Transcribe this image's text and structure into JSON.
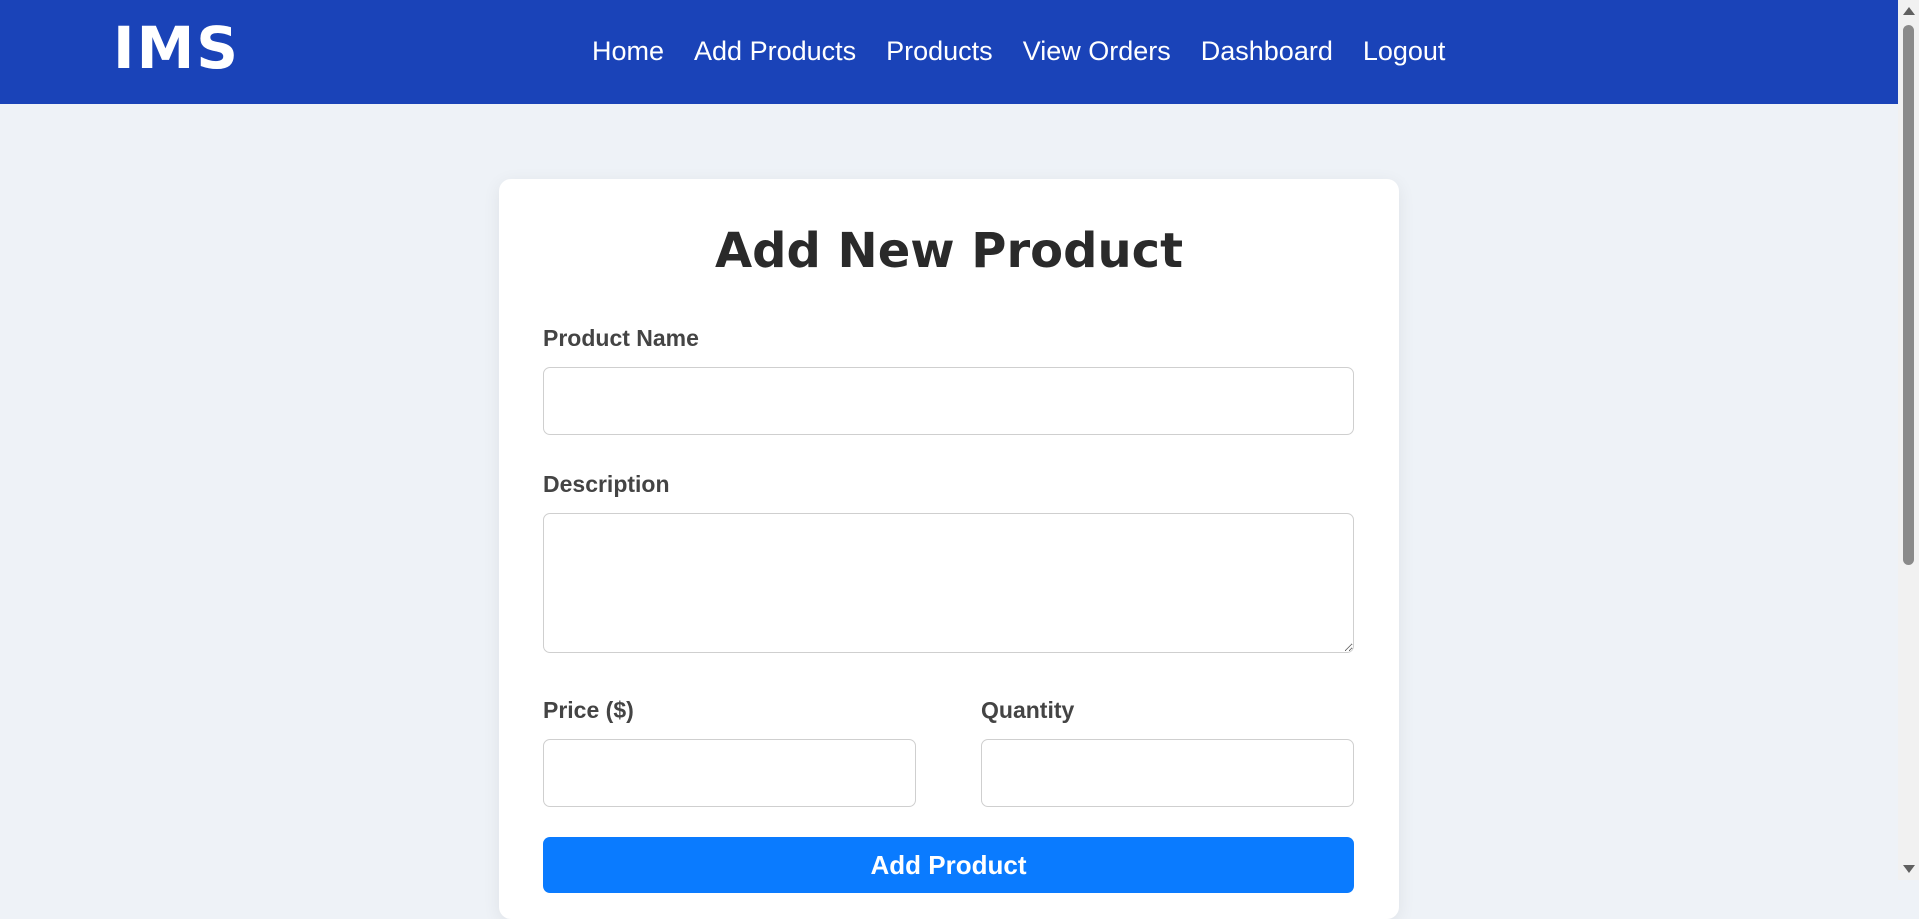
{
  "navbar": {
    "logo": "IMS",
    "links": [
      "Home",
      "Add Products",
      "Products",
      "View Orders",
      "Dashboard",
      "Logout"
    ],
    "background": "#1a43b8"
  },
  "form": {
    "title": "Add New Product",
    "product_name": {
      "label": "Product Name",
      "value": ""
    },
    "description": {
      "label": "Description",
      "value": ""
    },
    "price": {
      "label": "Price ($)",
      "value": ""
    },
    "quantity": {
      "label": "Quantity",
      "value": ""
    },
    "submit_label": "Add Product",
    "submit_color": "#0a7bff"
  },
  "icons": [
    "scroll-up-icon",
    "scroll-down-icon"
  ]
}
